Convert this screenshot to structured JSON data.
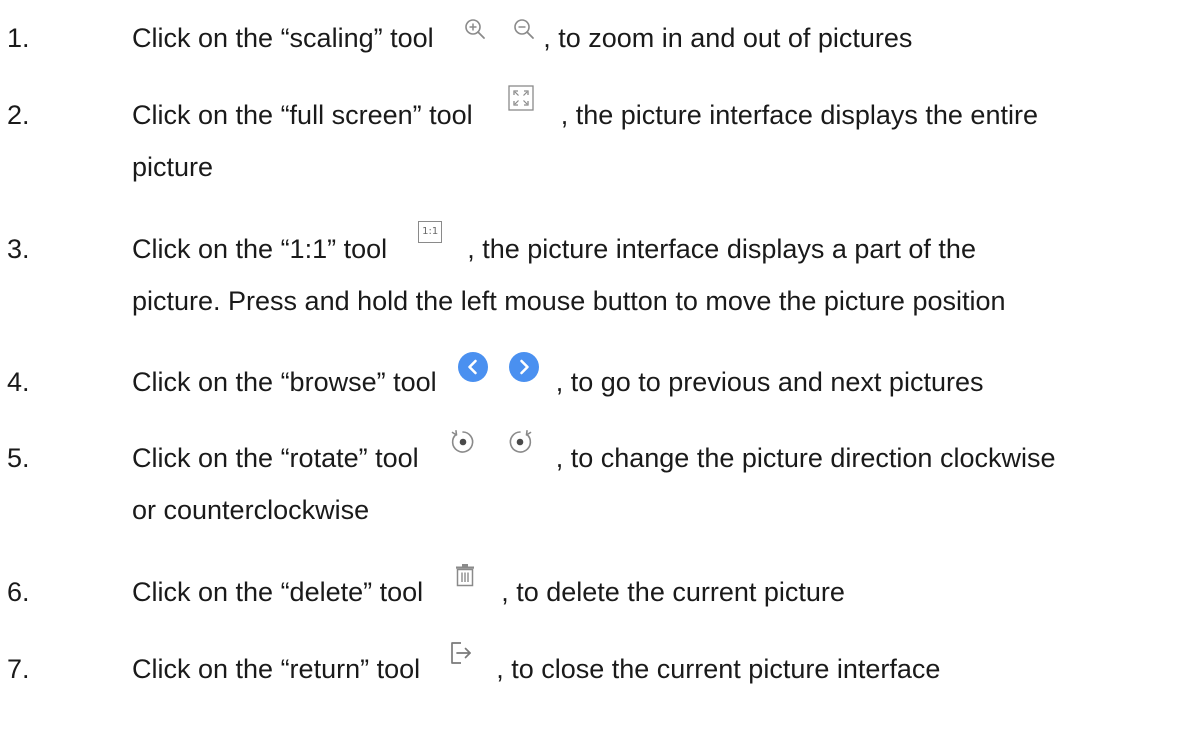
{
  "items": [
    {
      "number": "1.",
      "prefix": "Click on the “scaling” tool",
      "suffix": ", to zoom in and out of pictures",
      "icons": [
        "zoom-in-icon",
        "zoom-out-icon"
      ]
    },
    {
      "number": "2.",
      "prefix": "Click on the “full screen” tool",
      "suffix": ", the picture interface displays the entire",
      "continuation": "picture",
      "icons": [
        "fullscreen-icon"
      ]
    },
    {
      "number": "3.",
      "prefix": "Click on the “1:1” tool",
      "suffix": ", the picture interface displays a part of the",
      "continuation": "picture. Press and hold the left mouse button to move the picture position",
      "icons": [
        "one-to-one-icon"
      ],
      "icon_text": "1:1"
    },
    {
      "number": "4.",
      "prefix": "Click on the “browse” tool",
      "suffix": ", to go to previous and next pictures",
      "icons": [
        "previous-icon",
        "next-icon"
      ]
    },
    {
      "number": "5.",
      "prefix": "Click on the “rotate” tool",
      "suffix": ", to change the picture direction clockwise",
      "continuation": "or counterclockwise",
      "icons": [
        "rotate-counterclockwise-icon",
        "rotate-clockwise-icon"
      ]
    },
    {
      "number": "6.",
      "prefix": "Click on the “delete” tool",
      "suffix": ", to delete the current picture",
      "icons": [
        "trash-icon"
      ]
    },
    {
      "number": "7.",
      "prefix": "Click on the “return” tool",
      "suffix": ", to close the current picture interface",
      "icons": [
        "exit-icon"
      ]
    }
  ],
  "colors": {
    "text": "#1a1a1a",
    "icon_gray": "#8a8a8a",
    "browse_blue": "#4a90f0"
  }
}
